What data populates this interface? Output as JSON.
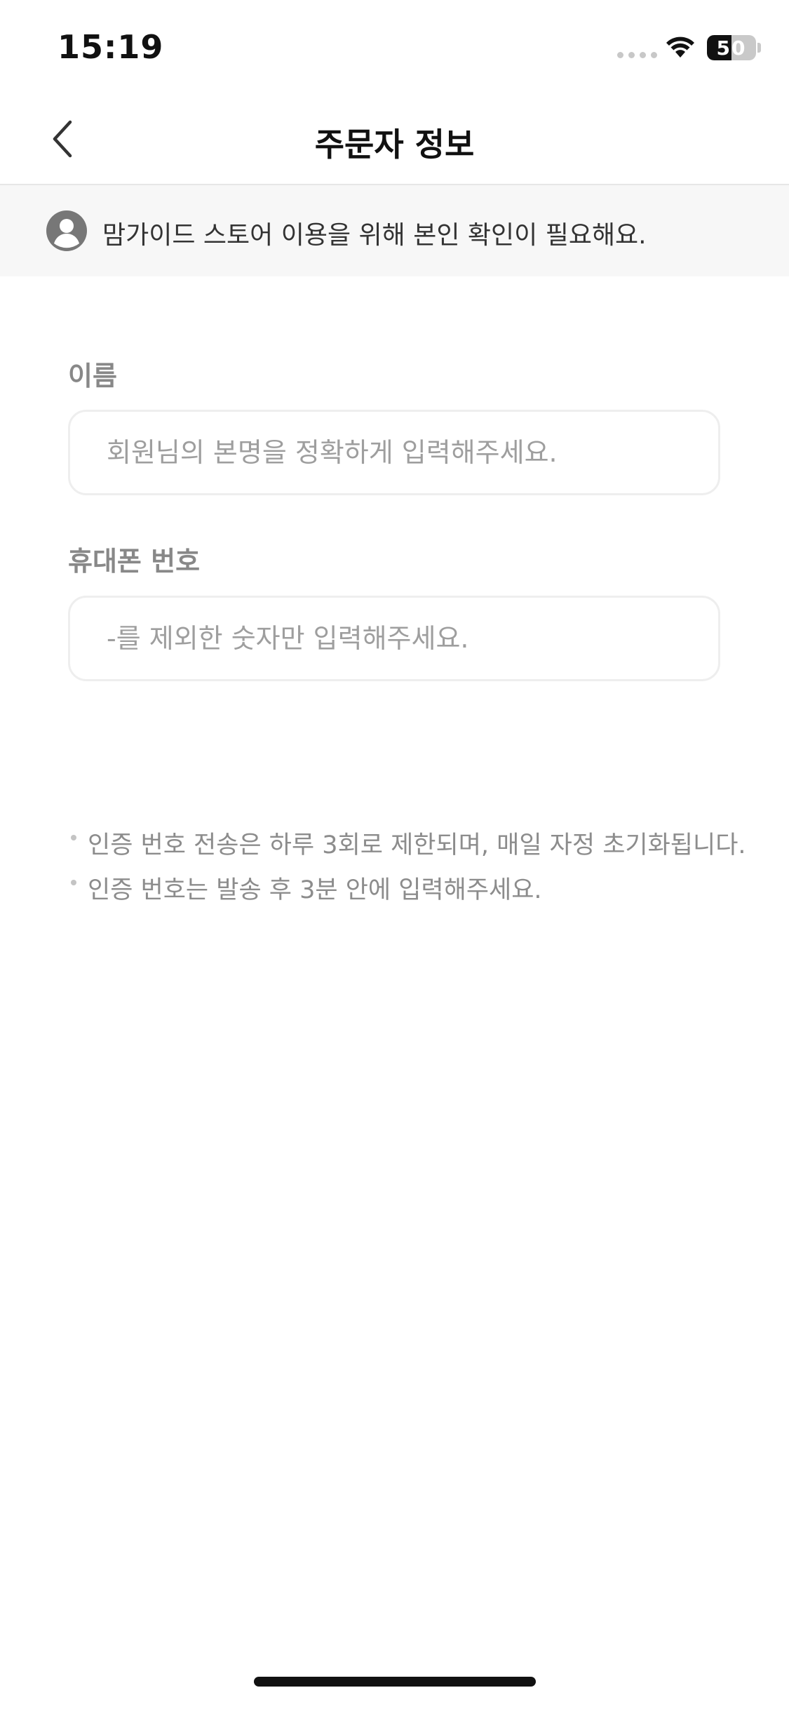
{
  "status_bar": {
    "time": "15:19",
    "battery_level": "50",
    "battery_fraction": 0.5
  },
  "nav": {
    "title": "주문자 정보"
  },
  "notice": {
    "text": "맘가이드 스토어 이용을 위해 본인 확인이 필요해요."
  },
  "form": {
    "name": {
      "label": "이름",
      "value": "",
      "placeholder": "회원님의 본명을 정확하게 입력해주세요."
    },
    "phone": {
      "label": "휴대폰 번호",
      "value": "",
      "placeholder": "-를 제외한 숫자만 입력해주세요."
    }
  },
  "notes": [
    "인증 번호 전송은 하루 3회로 제한되며, 매일 자정 초기화됩니다.",
    "인증 번호는 발송 후 3분 안에 입력해주세요."
  ],
  "colors": {
    "text_primary": "#111111",
    "label_gray": "#888888",
    "placeholder_gray": "#9e9e9e",
    "banner_bg": "#f7f7f7",
    "border": "#eeeeee"
  }
}
